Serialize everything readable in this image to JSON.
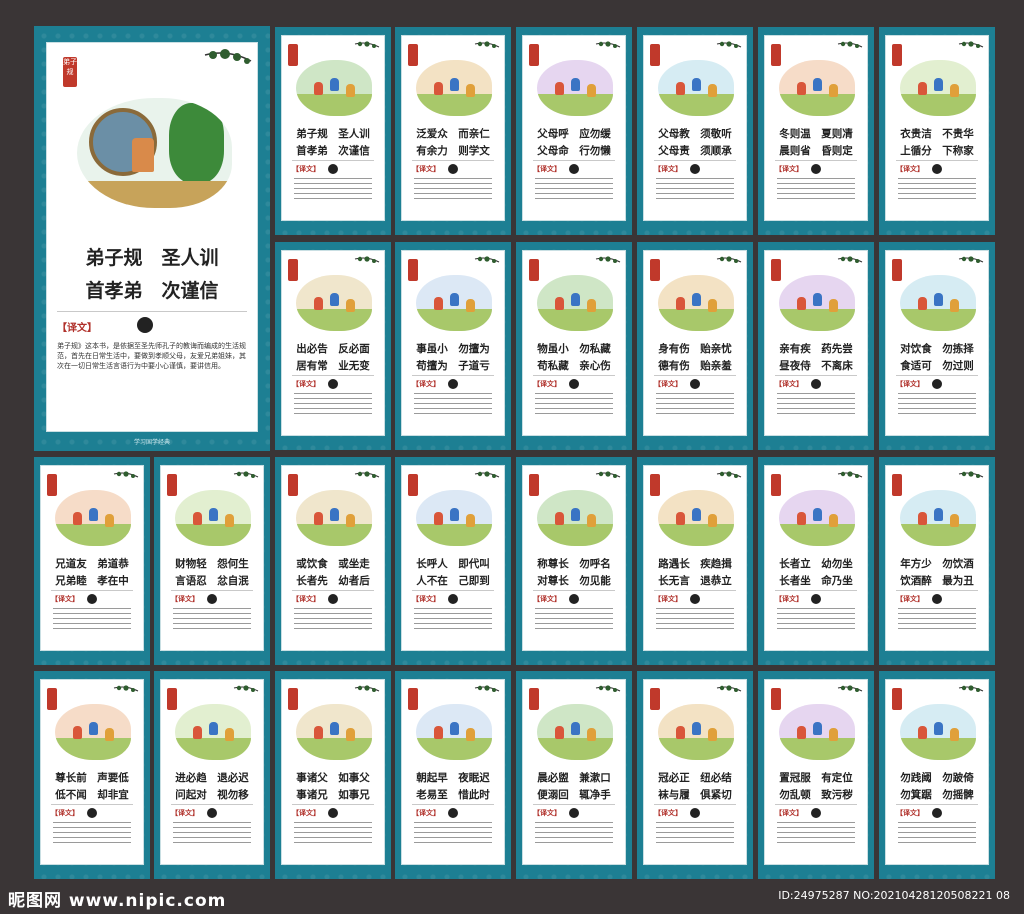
{
  "big_panel": {
    "seal": "弟子规",
    "line1": "弟子规　圣人训",
    "line2": "首孝弟　次谨信",
    "tag": "【译文】",
    "text": "弟子规》这本书，是依据至圣先师孔子的教诲而编成的生活规范，首先在日常生活中，要做到孝顺父母，友爱兄弟姐妹，其次在一切日常生活言语行为中要小心谨慎，要讲信用。",
    "footer": "学习国学经典"
  },
  "panel_tag": "【译文】",
  "panels": [
    {
      "l1": "弟子规　圣人训",
      "l2": "首孝弟　次谨信"
    },
    {
      "l1": "泛爱众　而亲仁",
      "l2": "有余力　则学文"
    },
    {
      "l1": "父母呼　应勿缓",
      "l2": "父母命　行勿懒"
    },
    {
      "l1": "父母教　须敬听",
      "l2": "父母责　须顺承"
    },
    {
      "l1": "冬则温　夏则凊",
      "l2": "晨则省　昏则定"
    },
    {
      "l1": "衣贵洁　不贵华",
      "l2": "上循分　下称家"
    },
    {
      "l1": "出必告　反必面",
      "l2": "居有常　业无变"
    },
    {
      "l1": "事虽小　勿擅为",
      "l2": "苟擅为　子道亏"
    },
    {
      "l1": "物虽小　勿私藏",
      "l2": "苟私藏　亲心伤"
    },
    {
      "l1": "身有伤　贻亲忧",
      "l2": "德有伤　贻亲羞"
    },
    {
      "l1": "亲有疾　药先尝",
      "l2": "昼夜侍　不离床"
    },
    {
      "l1": "对饮食　勿拣择",
      "l2": "食适可　勿过则"
    },
    {
      "l1": "兄道友　弟道恭",
      "l2": "兄弟睦　孝在中"
    },
    {
      "l1": "财物轻　怨何生",
      "l2": "言语忍　忿自泯"
    },
    {
      "l1": "或饮食　或坐走",
      "l2": "长者先　幼者后"
    },
    {
      "l1": "长呼人　即代叫",
      "l2": "人不在　己即到"
    },
    {
      "l1": "称尊长　勿呼名",
      "l2": "对尊长　勿见能"
    },
    {
      "l1": "路遇长　疾趋揖",
      "l2": "长无言　退恭立"
    },
    {
      "l1": "长者立　幼勿坐",
      "l2": "长者坐　命乃坐"
    },
    {
      "l1": "年方少　勿饮酒",
      "l2": "饮酒醉　最为丑"
    },
    {
      "l1": "尊长前　声要低",
      "l2": "低不闻　却非宜"
    },
    {
      "l1": "进必趋　退必迟",
      "l2": "问起对　视勿移"
    },
    {
      "l1": "事诸父　如事父",
      "l2": "事诸兄　如事兄"
    },
    {
      "l1": "朝起早　夜眠迟",
      "l2": "老易至　惜此时"
    },
    {
      "l1": "晨必盥　兼漱口",
      "l2": "便溺回　辄净手"
    },
    {
      "l1": "冠必正　纽必结",
      "l2": "袜与履　俱紧切"
    },
    {
      "l1": "置冠服　有定位",
      "l2": "勿乱顿　致污秽"
    },
    {
      "l1": "勿践阈　勿跛倚",
      "l2": "勿箕踞　勿摇髀"
    }
  ],
  "watermark": {
    "brand": "昵图网 www.nipic.com",
    "id": "ID:24975287 NO:20210428120508221 08"
  },
  "colors": {
    "board": "#1d7f93",
    "seal": "#c0392b",
    "ground": "#a8c86a",
    "background": "#3a3536"
  }
}
